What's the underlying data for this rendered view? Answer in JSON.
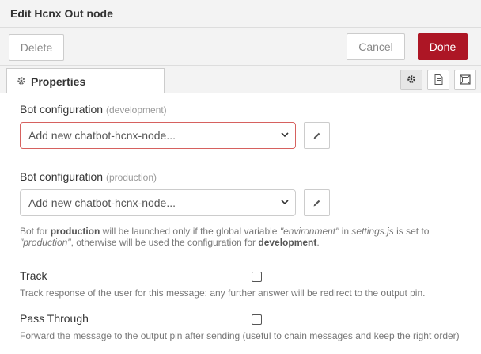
{
  "title": "Edit Hcnx Out node",
  "actions": {
    "delete_label": "Delete",
    "cancel_label": "Cancel",
    "done_label": "Done"
  },
  "tabs": {
    "properties_label": "Properties",
    "properties_icon": "gear-icon",
    "tool_icons": [
      "gear-icon",
      "document-icon",
      "frame-icon"
    ]
  },
  "fields": {
    "bot_dev": {
      "label": "Bot configuration",
      "hint": "(development)",
      "value": "Add new chatbot-hcnx-node..."
    },
    "bot_prod": {
      "label": "Bot configuration",
      "hint": "(production)",
      "value": "Add new chatbot-hcnx-node..."
    },
    "help": {
      "p1": "Bot for ",
      "production_bold": "production",
      "p2": " will be launched only if the global variable ",
      "environment_italic": "\"environment\"",
      "p3": " in ",
      "settings_italic": "settings.js",
      "p4": " is set to",
      "production_italic": "\"production\"",
      "p5": ", otherwise will be used the configuration for ",
      "development_bold": "development",
      "p6": "."
    },
    "track": {
      "label": "Track",
      "checked": false,
      "description": "Track response of the user for this message: any further answer will be redirect to the output pin."
    },
    "pass_through": {
      "label": "Pass Through",
      "checked": false,
      "description": "Forward the message to the output pin after sending (useful to chain messages and keep the right order)"
    }
  },
  "colors": {
    "done_button": "#ad1625",
    "error_border": "#d6615f"
  }
}
